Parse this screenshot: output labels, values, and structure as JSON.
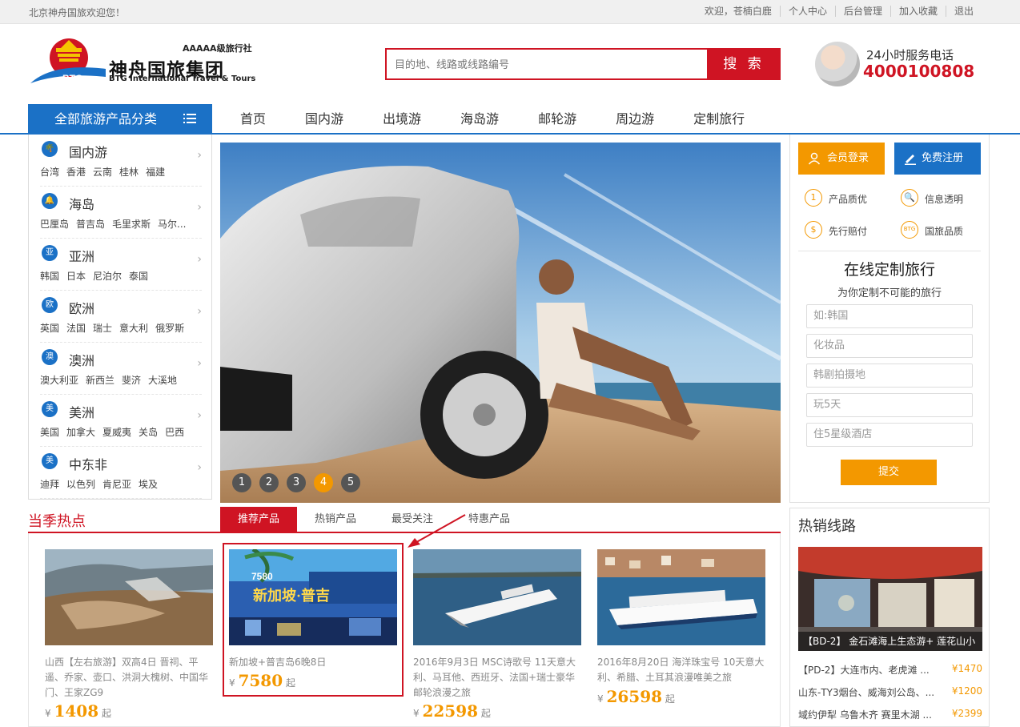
{
  "topbar": {
    "welcome": "北京神舟国旅欢迎您！",
    "links": [
      "欢迎，苍楠白鹿",
      "个人中心",
      "后台管理",
      "加入收藏",
      "退出"
    ]
  },
  "header": {
    "logo_cn": "神舟国旅集团",
    "logo_en": "BTG International Travel & Tours",
    "logo_grade": "AAAAA级旅行社",
    "search_placeholder": "目的地、线路或线路编号",
    "search_button": "搜 索",
    "hotline_label": "24小时服务电话",
    "hotline_number": "4000100808"
  },
  "nav": {
    "category_label": "全部旅游产品分类",
    "items": [
      "首页",
      "国内游",
      "出境游",
      "海岛游",
      "邮轮游",
      "周边游",
      "定制旅行"
    ]
  },
  "sidebar": {
    "items": [
      {
        "icon": "palm-icon",
        "glyph": "🌴",
        "name": "国内游",
        "subs": [
          "台湾",
          "香港",
          "云南",
          "桂林",
          "福建"
        ]
      },
      {
        "icon": "bell-icon",
        "glyph": "🔔",
        "name": "海岛",
        "subs": [
          "巴厘岛",
          "普吉岛",
          "毛里求斯",
          "马尔..."
        ]
      },
      {
        "icon": "asia-icon",
        "glyph": "亚",
        "name": "亚洲",
        "subs": [
          "韩国",
          "日本",
          "尼泊尔",
          "泰国"
        ]
      },
      {
        "icon": "europe-icon",
        "glyph": "欧",
        "name": "欧洲",
        "subs": [
          "英国",
          "法国",
          "瑞士",
          "意大利",
          "俄罗斯"
        ]
      },
      {
        "icon": "oceania-icon",
        "glyph": "澳",
        "name": "澳洲",
        "subs": [
          "澳大利亚",
          "新西兰",
          "斐济",
          "大溪地"
        ]
      },
      {
        "icon": "america-icon",
        "glyph": "美",
        "name": "美洲",
        "subs": [
          "美国",
          "加拿大",
          "夏威夷",
          "关岛",
          "巴西"
        ]
      },
      {
        "icon": "mideast-icon",
        "glyph": "美",
        "name": "中东非",
        "subs": [
          "迪拜",
          "以色列",
          "肯尼亚",
          "埃及"
        ]
      }
    ]
  },
  "banner": {
    "dots": [
      "1",
      "2",
      "3",
      "4",
      "5"
    ],
    "active_dot": "4"
  },
  "member": {
    "login": "会员登录",
    "register": "免费注册",
    "features": [
      "产品质优",
      "信息透明",
      "先行赔付",
      "国旅品质"
    ],
    "feature_glyphs": [
      "1",
      "🔍",
      "$",
      "BTG"
    ]
  },
  "custom": {
    "title": "在线定制旅行",
    "subtitle": "为你定制不可能的旅行",
    "fields": [
      "如:韩国",
      "化妆品",
      "韩剧拍摄地",
      "玩5天",
      "住5星级酒店"
    ],
    "submit": "提交"
  },
  "hot": {
    "title": "当季热点",
    "tabs": [
      "推荐产品",
      "热销产品",
      "最受关注",
      "特惠产品"
    ],
    "active_tab": "推荐产品",
    "products": [
      {
        "desc": "山西【左右旅游】双高4日 晋祠、平遥、乔家、壶口、洪洞大槐树、中国华门、王家ZG9",
        "currency": "¥",
        "price": "1408",
        "suffix": "起"
      },
      {
        "desc": "新加坡+普吉岛6晚8日",
        "currency": "¥",
        "price": "7580",
        "suffix": "起",
        "poster_price": "7580",
        "poster_title": "新加坡·普吉"
      },
      {
        "desc": "2016年9月3日 MSC诗歌号 11天意大利、马耳他、西班牙、法国+瑞士豪华邮轮浪漫之旅",
        "currency": "¥",
        "price": "22598",
        "suffix": "起"
      },
      {
        "desc": "2016年8月20日 海洋珠宝号 10天意大利、希腊、土耳其浪漫唯美之旅",
        "currency": "¥",
        "price": "26598",
        "suffix": "起"
      }
    ]
  },
  "routes": {
    "title": "热销线路",
    "caption": "【BD-2】 金石滩海上生态游+ 莲花山小",
    "list": [
      {
        "name": "【PD-2】大连市内、老虎滩 ...",
        "price": "¥1470"
      },
      {
        "name": "山东-TY3烟台、威海刘公岛、...",
        "price": "¥1200"
      },
      {
        "name": "域约伊犁 乌鲁木齐 赛里木湖 ...",
        "price": "¥2399"
      }
    ]
  },
  "colors": {
    "brand_red": "#cf1423",
    "brand_blue": "#1b71c6",
    "accent_orange": "#f39800"
  }
}
